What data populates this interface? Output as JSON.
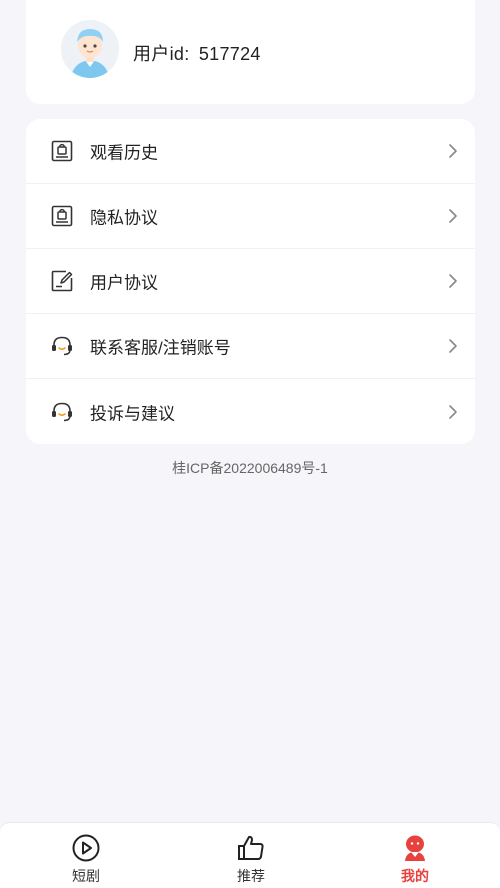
{
  "profile": {
    "user_id_label": "用户id",
    "user_id_sep": ":",
    "user_id_value": "517724"
  },
  "menu": {
    "items": [
      {
        "label": "观看历史",
        "icon": "history-icon"
      },
      {
        "label": "隐私协议",
        "icon": "privacy-icon"
      },
      {
        "label": "用户协议",
        "icon": "agreement-icon"
      },
      {
        "label": "联系客服/注销账号",
        "icon": "headset-icon"
      },
      {
        "label": "投诉与建议",
        "icon": "headset-icon"
      }
    ]
  },
  "footer": {
    "icp": "桂ICP备2022006489号-1"
  },
  "tabbar": {
    "tabs": [
      {
        "label": "短剧",
        "icon": "play-circle-icon",
        "active": false
      },
      {
        "label": "推荐",
        "icon": "thumbs-up-icon",
        "active": false
      },
      {
        "label": "我的",
        "icon": "profile-icon",
        "active": true
      }
    ]
  },
  "colors": {
    "background": "#f6f6fa",
    "card": "#ffffff",
    "accent": "#e8423f",
    "text": "#222222",
    "muted": "#666666"
  }
}
